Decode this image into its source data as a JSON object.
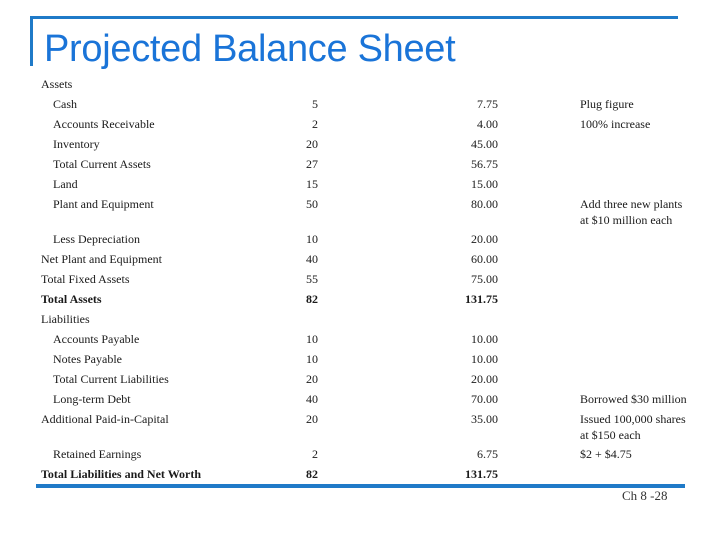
{
  "title": "Projected Balance Sheet",
  "footer": "Ch 8 -28",
  "accent_color": "#1f7ac8",
  "rows": [
    {
      "label": "Assets",
      "v1": "",
      "v2": "",
      "note": "",
      "indent": false,
      "bold": false
    },
    {
      "label": "Cash",
      "v1": "5",
      "v2": "7.75",
      "note": "Plug figure",
      "indent": true,
      "bold": false
    },
    {
      "label": "Accounts Receivable",
      "v1": "2",
      "v2": "4.00",
      "note": "100% increase",
      "indent": true,
      "bold": false
    },
    {
      "label": "Inventory",
      "v1": "20",
      "v2": "45.00",
      "note": "",
      "indent": true,
      "bold": false
    },
    {
      "label": "Total Current Assets",
      "v1": "27",
      "v2": "56.75",
      "note": "",
      "indent": true,
      "bold": false
    },
    {
      "label": "Land",
      "v1": "15",
      "v2": "15.00",
      "note": "",
      "indent": true,
      "bold": false
    },
    {
      "label": "Plant and Equipment",
      "v1": "50",
      "v2": "80.00",
      "note": "Add three new plants",
      "note2": "at $10 million each",
      "indent": true,
      "bold": false
    },
    {
      "label": "Less Depreciation",
      "v1": "10",
      "v2": "20.00",
      "note": "",
      "indent": true,
      "bold": false
    },
    {
      "label": "Net Plant and Equipment",
      "v1": "40",
      "v2": "60.00",
      "note": "",
      "indent": false,
      "bold": false
    },
    {
      "label": "Total Fixed Assets",
      "v1": "55",
      "v2": "75.00",
      "note": "",
      "indent": false,
      "bold": false
    },
    {
      "label": "Total Assets",
      "v1": "82",
      "v2": "131.75",
      "note": "",
      "indent": false,
      "bold": true
    },
    {
      "label": "Liabilities",
      "v1": "",
      "v2": "",
      "note": "",
      "indent": false,
      "bold": false
    },
    {
      "label": "Accounts Payable",
      "v1": "10",
      "v2": "10.00",
      "note": "",
      "indent": true,
      "bold": false
    },
    {
      "label": "Notes Payable",
      "v1": "10",
      "v2": "10.00",
      "note": "",
      "indent": true,
      "bold": false
    },
    {
      "label": "Total Current Liabilities",
      "v1": "20",
      "v2": "20.00",
      "note": "",
      "indent": true,
      "bold": false
    },
    {
      "label": "Long-term Debt",
      "v1": "40",
      "v2": "70.00",
      "note": "Borrowed $30 million",
      "indent": true,
      "bold": false
    },
    {
      "label": "Additional Paid-in-Capital",
      "v1": "20",
      "v2": "35.00",
      "note": "Issued 100,000 shares",
      "note2": "at $150 each",
      "indent": false,
      "bold": false
    },
    {
      "label": "Retained Earnings",
      "v1": "2",
      "v2": "6.75",
      "note": "$2 + $4.75",
      "indent": true,
      "bold": false
    },
    {
      "label": "Total Liabilities and Net Worth",
      "v1": "82",
      "v2": "131.75",
      "note": "",
      "indent": false,
      "bold": true
    }
  ]
}
